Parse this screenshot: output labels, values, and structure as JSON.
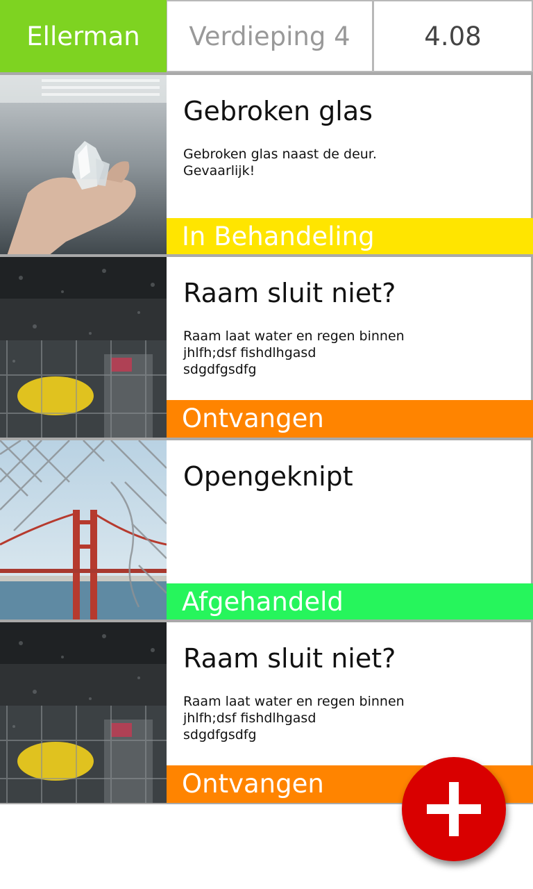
{
  "header": {
    "building": "Ellerman",
    "floor": "Verdieping 4",
    "room": "4.08",
    "building_color": "#7ed321"
  },
  "reports": [
    {
      "image": "hand-holding-glass-shards-photo",
      "title": "Gebroken glas",
      "description": "Gebroken glas naast de deur.\nGevaarlijk!",
      "status": "In Behandeling",
      "status_color": "#ffe500"
    },
    {
      "image": "rainy-window-photo",
      "title": "Raam sluit niet?",
      "description": "Raam laat water en regen binnen\njhlfh;dsf fishdlhgasd\nsdgdfgsdfg",
      "status": "Ontvangen",
      "status_color": "#ff8400"
    },
    {
      "image": "cut-fence-golden-gate-photo",
      "title": "Opengeknipt",
      "description": "",
      "status": "Afgehandeld",
      "status_color": "#26f55c"
    },
    {
      "image": "rainy-window-photo",
      "title": "Raam sluit niet?",
      "description": "Raam laat water en regen binnen\njhlfh;dsf fishdlhgasd\nsdgdfgsdfg",
      "status": "Ontvangen",
      "status_color": "#ff8400"
    }
  ],
  "fab": {
    "icon": "plus-icon",
    "color": "#d90000"
  }
}
